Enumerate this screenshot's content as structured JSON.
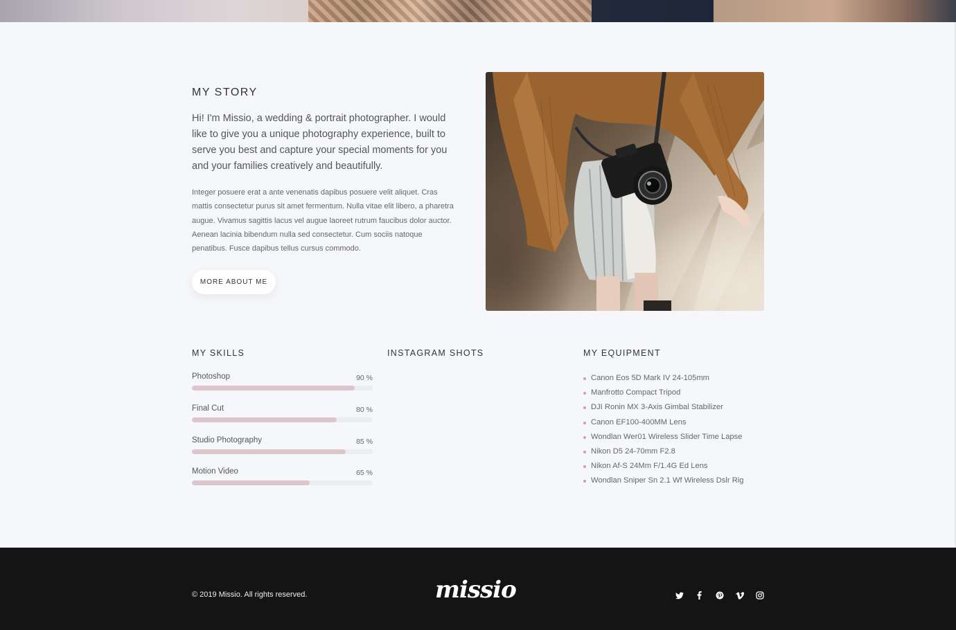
{
  "story": {
    "title": "MY STORY",
    "lead": "Hi! I'm Missio, a wedding & portrait photographer. I would like to give you a unique photography experience, built to serve you best and capture your special moments for you and your families creatively and beautifully.",
    "body": "Integer posuere erat a ante venenatis dapibus posuere velit aliquet. Cras mattis consectetur purus sit amet fermentum. Nulla vitae elit libero, a pharetra augue. Vivamus sagittis lacus vel augue laoreet rutrum faucibus dolor auctor. Aenean lacinia bibendum nulla sed consectetur. Cum sociis natoque penatibus. Fusce dapibus tellus cursus commodo.",
    "button_label": "MORE ABOUT ME"
  },
  "skills": {
    "title": "MY SKILLS",
    "items": [
      {
        "name": "Photoshop",
        "percent_label": "90 %",
        "level": 0.9
      },
      {
        "name": "Final Cut",
        "percent_label": "80 %",
        "level": 0.8
      },
      {
        "name": "Studio Photography",
        "percent_label": "85 %",
        "level": 0.85
      },
      {
        "name": "Motion Video",
        "percent_label": "65 %",
        "level": 0.65
      }
    ]
  },
  "instagram": {
    "title": "INSTAGRAM SHOTS"
  },
  "equipment": {
    "title": "MY EQUIPMENT",
    "items": [
      "Canon Eos 5D Mark IV 24-105mm",
      "Manfrotto Compact Tripod",
      "DJI Ronin MX 3-Axis Gimbal Stabilizer",
      "Canon EF100-400MM Lens",
      "Wondlan Wer01 Wireless Slider Time Lapse",
      "Nikon D5 24-70mm F2.8",
      "Nikon Af-S 24Mm F/1.4G Ed Lens",
      "Wondlan Sniper Sn 2.1 Wf Wireless Dslr Rig"
    ]
  },
  "footer": {
    "copyright": "© 2019 Missio. All rights reserved.",
    "logo_text": "missio",
    "socials": [
      "twitter-icon",
      "facebook-icon",
      "pinterest-icon",
      "vimeo-icon",
      "instagram-icon"
    ]
  },
  "colors": {
    "background": "#f5f7fa",
    "accent_bar": "#dcc6cb",
    "bullet": "#c9a1aa",
    "footer_bg": "#141414"
  }
}
